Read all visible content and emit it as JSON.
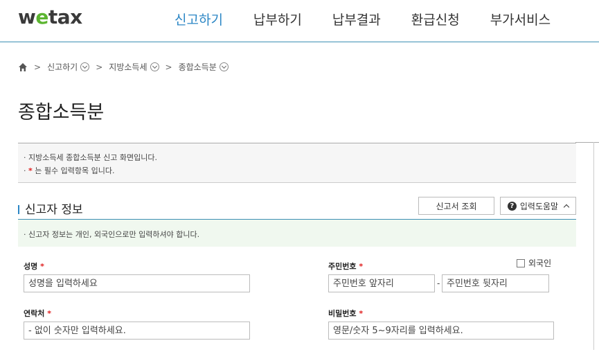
{
  "header": {
    "logo_pre": "w",
    "logo_e": "e",
    "logo_post": "tax",
    "nav": [
      {
        "label": "신고하기",
        "active": true
      },
      {
        "label": "납부하기",
        "active": false
      },
      {
        "label": "납부결과",
        "active": false
      },
      {
        "label": "환급신청",
        "active": false
      },
      {
        "label": "부가서비스",
        "active": false
      }
    ]
  },
  "breadcrumb": {
    "sep": ">",
    "items": [
      "신고하기",
      "지방소득세",
      "종합소득분"
    ]
  },
  "page_title": "종합소득분",
  "notice": {
    "line1": "· 지방소득세 종합소득분 신고 화면입니다.",
    "line2_prefix": "· ",
    "line2_star": "*",
    "line2_suffix": " 는 필수 입력항목 입니다."
  },
  "section": {
    "title": "신고자 정보",
    "inquiry_button": "신고서 조회",
    "help_button": "입력도움말",
    "info": "· 신고자 정보는 개인, 외국인으로만 입력하셔야 합니다."
  },
  "form": {
    "required_mark": "*",
    "name": {
      "label": "성명",
      "placeholder": "성명을 입력하세요"
    },
    "rrn": {
      "label": "주민번호",
      "front_placeholder": "주민번호 앞자리",
      "dash": "-",
      "back_placeholder": "주민번호 뒷자리"
    },
    "foreigner": {
      "label": "외국인",
      "checked": false
    },
    "phone": {
      "label": "연락처",
      "placeholder": "- 없이 숫자만 입력하세요."
    },
    "password": {
      "label": "비밀번호",
      "placeholder": "영문/숫자 5~9자리를 입력하세요."
    }
  },
  "colors": {
    "accent": "#2b86c5",
    "brand_green": "#5cb531",
    "required": "#e02020",
    "info_bg": "#f0f8ef"
  }
}
